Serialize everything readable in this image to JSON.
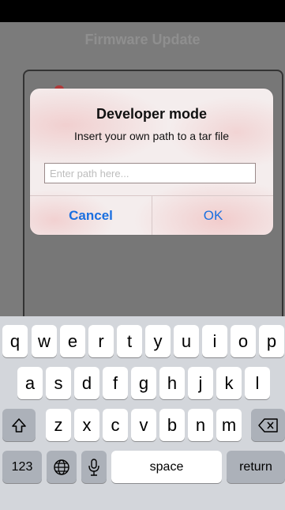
{
  "screen": {
    "title": "Firmware Update"
  },
  "dialog": {
    "title": "Developer mode",
    "message": "Insert your own path to a tar file",
    "input_placeholder": "Enter path here...",
    "input_value": "",
    "cancel_label": "Cancel",
    "ok_label": "OK"
  },
  "keyboard": {
    "row1": [
      "q",
      "w",
      "e",
      "r",
      "t",
      "y",
      "u",
      "i",
      "o",
      "p"
    ],
    "row2": [
      "a",
      "s",
      "d",
      "f",
      "g",
      "h",
      "j",
      "k",
      "l"
    ],
    "row3": [
      "z",
      "x",
      "c",
      "v",
      "b",
      "n",
      "m"
    ],
    "numbers_label": "123",
    "space_label": "space",
    "return_label": "return",
    "shift_icon": "shift-icon",
    "delete_icon": "delete-icon",
    "globe_icon": "globe-icon",
    "mic_icon": "microphone-icon"
  },
  "colors": {
    "accent": "#1a6fe0",
    "dialog_bg": "#f4eded",
    "keyboard_bg": "#d3d6db"
  }
}
